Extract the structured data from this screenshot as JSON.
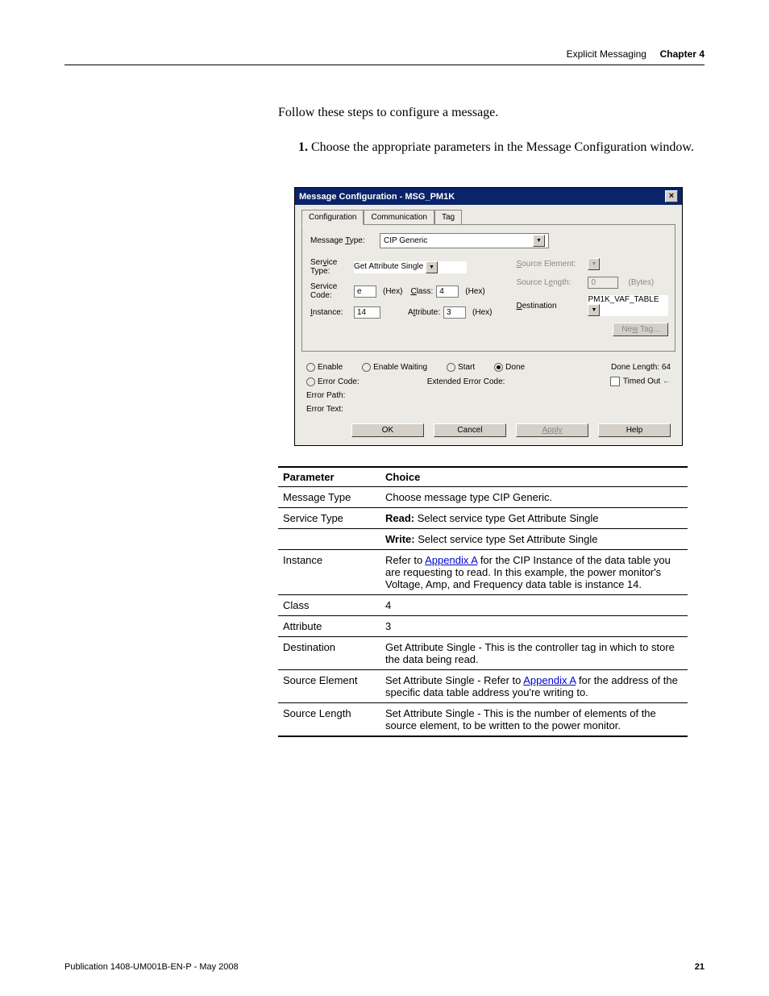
{
  "header": {
    "breadcrumb": "Explicit Messaging",
    "chapter": "Chapter 4"
  },
  "intro": "Follow these steps to configure a message.",
  "step1": {
    "num": "1.",
    "text": "Choose the appropriate parameters in the Message Configuration window."
  },
  "dialog": {
    "title": "Message Configuration - MSG_PM1K",
    "close": "×",
    "tabs": {
      "t1": "Configuration",
      "t2": "Communication",
      "t3": "Tag"
    },
    "msgTypeLabel": "Message Type:",
    "msgTypeValue": "CIP Generic",
    "svcTypeLabel": "Service Type:",
    "svcTypeValue": "Get Attribute Single",
    "svcCodeLabel": "Service Code:",
    "svcCodeValue": "e",
    "classLabel": "Class:",
    "classValue": "4",
    "instanceLabel": "Instance:",
    "instanceValue": "14",
    "attributeLabel": "Attribute:",
    "attributeValue": "3",
    "hex": "(Hex)",
    "srcElemLabel": "Source Element:",
    "srcLenLabel": "Source Length:",
    "srcLenValue": "0",
    "bytes": "(Bytes)",
    "destLabel": "Destination",
    "destValue": "PM1K_VAF_TABLE",
    "newTag": "New Tag...",
    "status": {
      "enable": "Enable",
      "enableWaiting": "Enable Waiting",
      "start": "Start",
      "done": "Done",
      "doneLen": "Done Length: 64",
      "errCode": "Error Code:",
      "extErr": "Extended Error Code:",
      "timedOut": "Timed Out ",
      "errPath": "Error Path:",
      "errText": "Error Text:"
    },
    "buttons": {
      "ok": "OK",
      "cancel": "Cancel",
      "apply": "Apply",
      "help": "Help"
    }
  },
  "table": {
    "h1": "Parameter",
    "h2": "Choice",
    "rows": [
      {
        "p": "Message Type",
        "c": "Choose message type CIP Generic."
      },
      {
        "p": "Service Type",
        "c_pre": "Read",
        "c_colon": ": ",
        "c_post": "Select service type Get Attribute Single"
      },
      {
        "p": "",
        "c_pre": "Write",
        "c_colon": ": ",
        "c_post": "Select service type Set Attribute Single"
      },
      {
        "p": "Instance",
        "c_pre": "Refer to ",
        "link": "Appendix A",
        "c_post": " for the CIP Instance of the data table you are requesting to read. In this example, the power monitor's Voltage, Amp, and Frequency data table is instance 14."
      },
      {
        "p": "Class",
        "c": "4"
      },
      {
        "p": "Attribute",
        "c": "3"
      },
      {
        "p": "Destination",
        "c": "Get Attribute Single - This is the controller tag in which to store the data being read."
      },
      {
        "p": "Source Element",
        "c_pre": "Set Attribute Single - Refer to ",
        "link": "Appendix A",
        "c_post": " for the address of the specific data table address you're writing to."
      },
      {
        "p": "Source Length",
        "c": "Set Attribute Single - This is the number of elements of the source element, to be written to the power monitor."
      }
    ]
  },
  "footer": {
    "pub": "Publication 1408-UM001B-EN-P - May 2008",
    "page": "21"
  }
}
